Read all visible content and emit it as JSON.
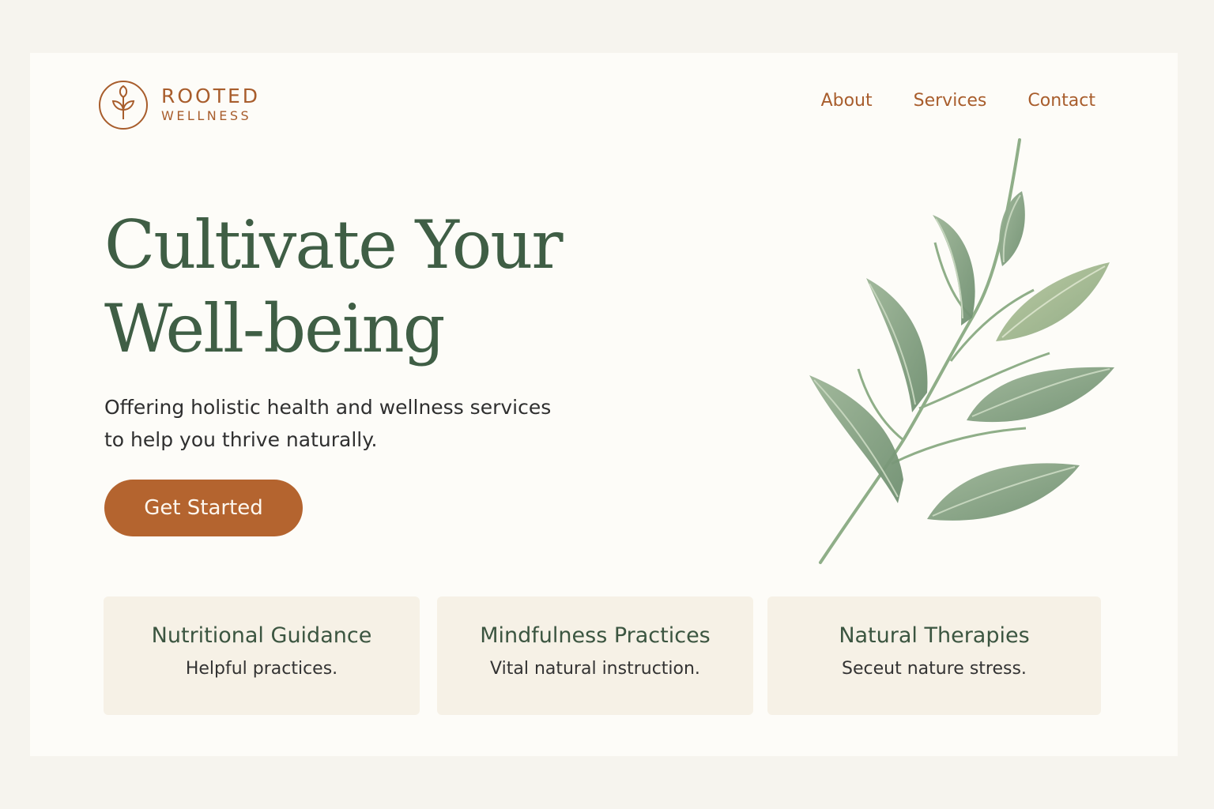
{
  "brand": {
    "name_line1": "ROOTED",
    "name_line2": "WELLNESS",
    "icon": "sprout-icon",
    "color": "#a85d2c"
  },
  "nav": {
    "items": [
      {
        "label": "About"
      },
      {
        "label": "Services"
      },
      {
        "label": "Contact"
      }
    ]
  },
  "hero": {
    "title_line1": "Cultivate Your",
    "title_line2": "Well-being",
    "subtitle_line1": "Offering holistic health and wellness services",
    "subtitle_line2": "to help you thrive naturally.",
    "cta_label": "Get Started",
    "illustration": "leaf-branch-icon"
  },
  "services": [
    {
      "title": "Nutritional Guidance",
      "description": "Helpful practices."
    },
    {
      "title": "Mindfulness Practices",
      "description": "Vital natural instruction."
    },
    {
      "title": "Natural Therapies",
      "description": "Seceut nature stress."
    }
  ],
  "colors": {
    "accent": "#b4642f",
    "heading": "#3f5e45",
    "background": "#fdfcf8",
    "card": "#f6f1e6",
    "leaf": "#86a384"
  }
}
